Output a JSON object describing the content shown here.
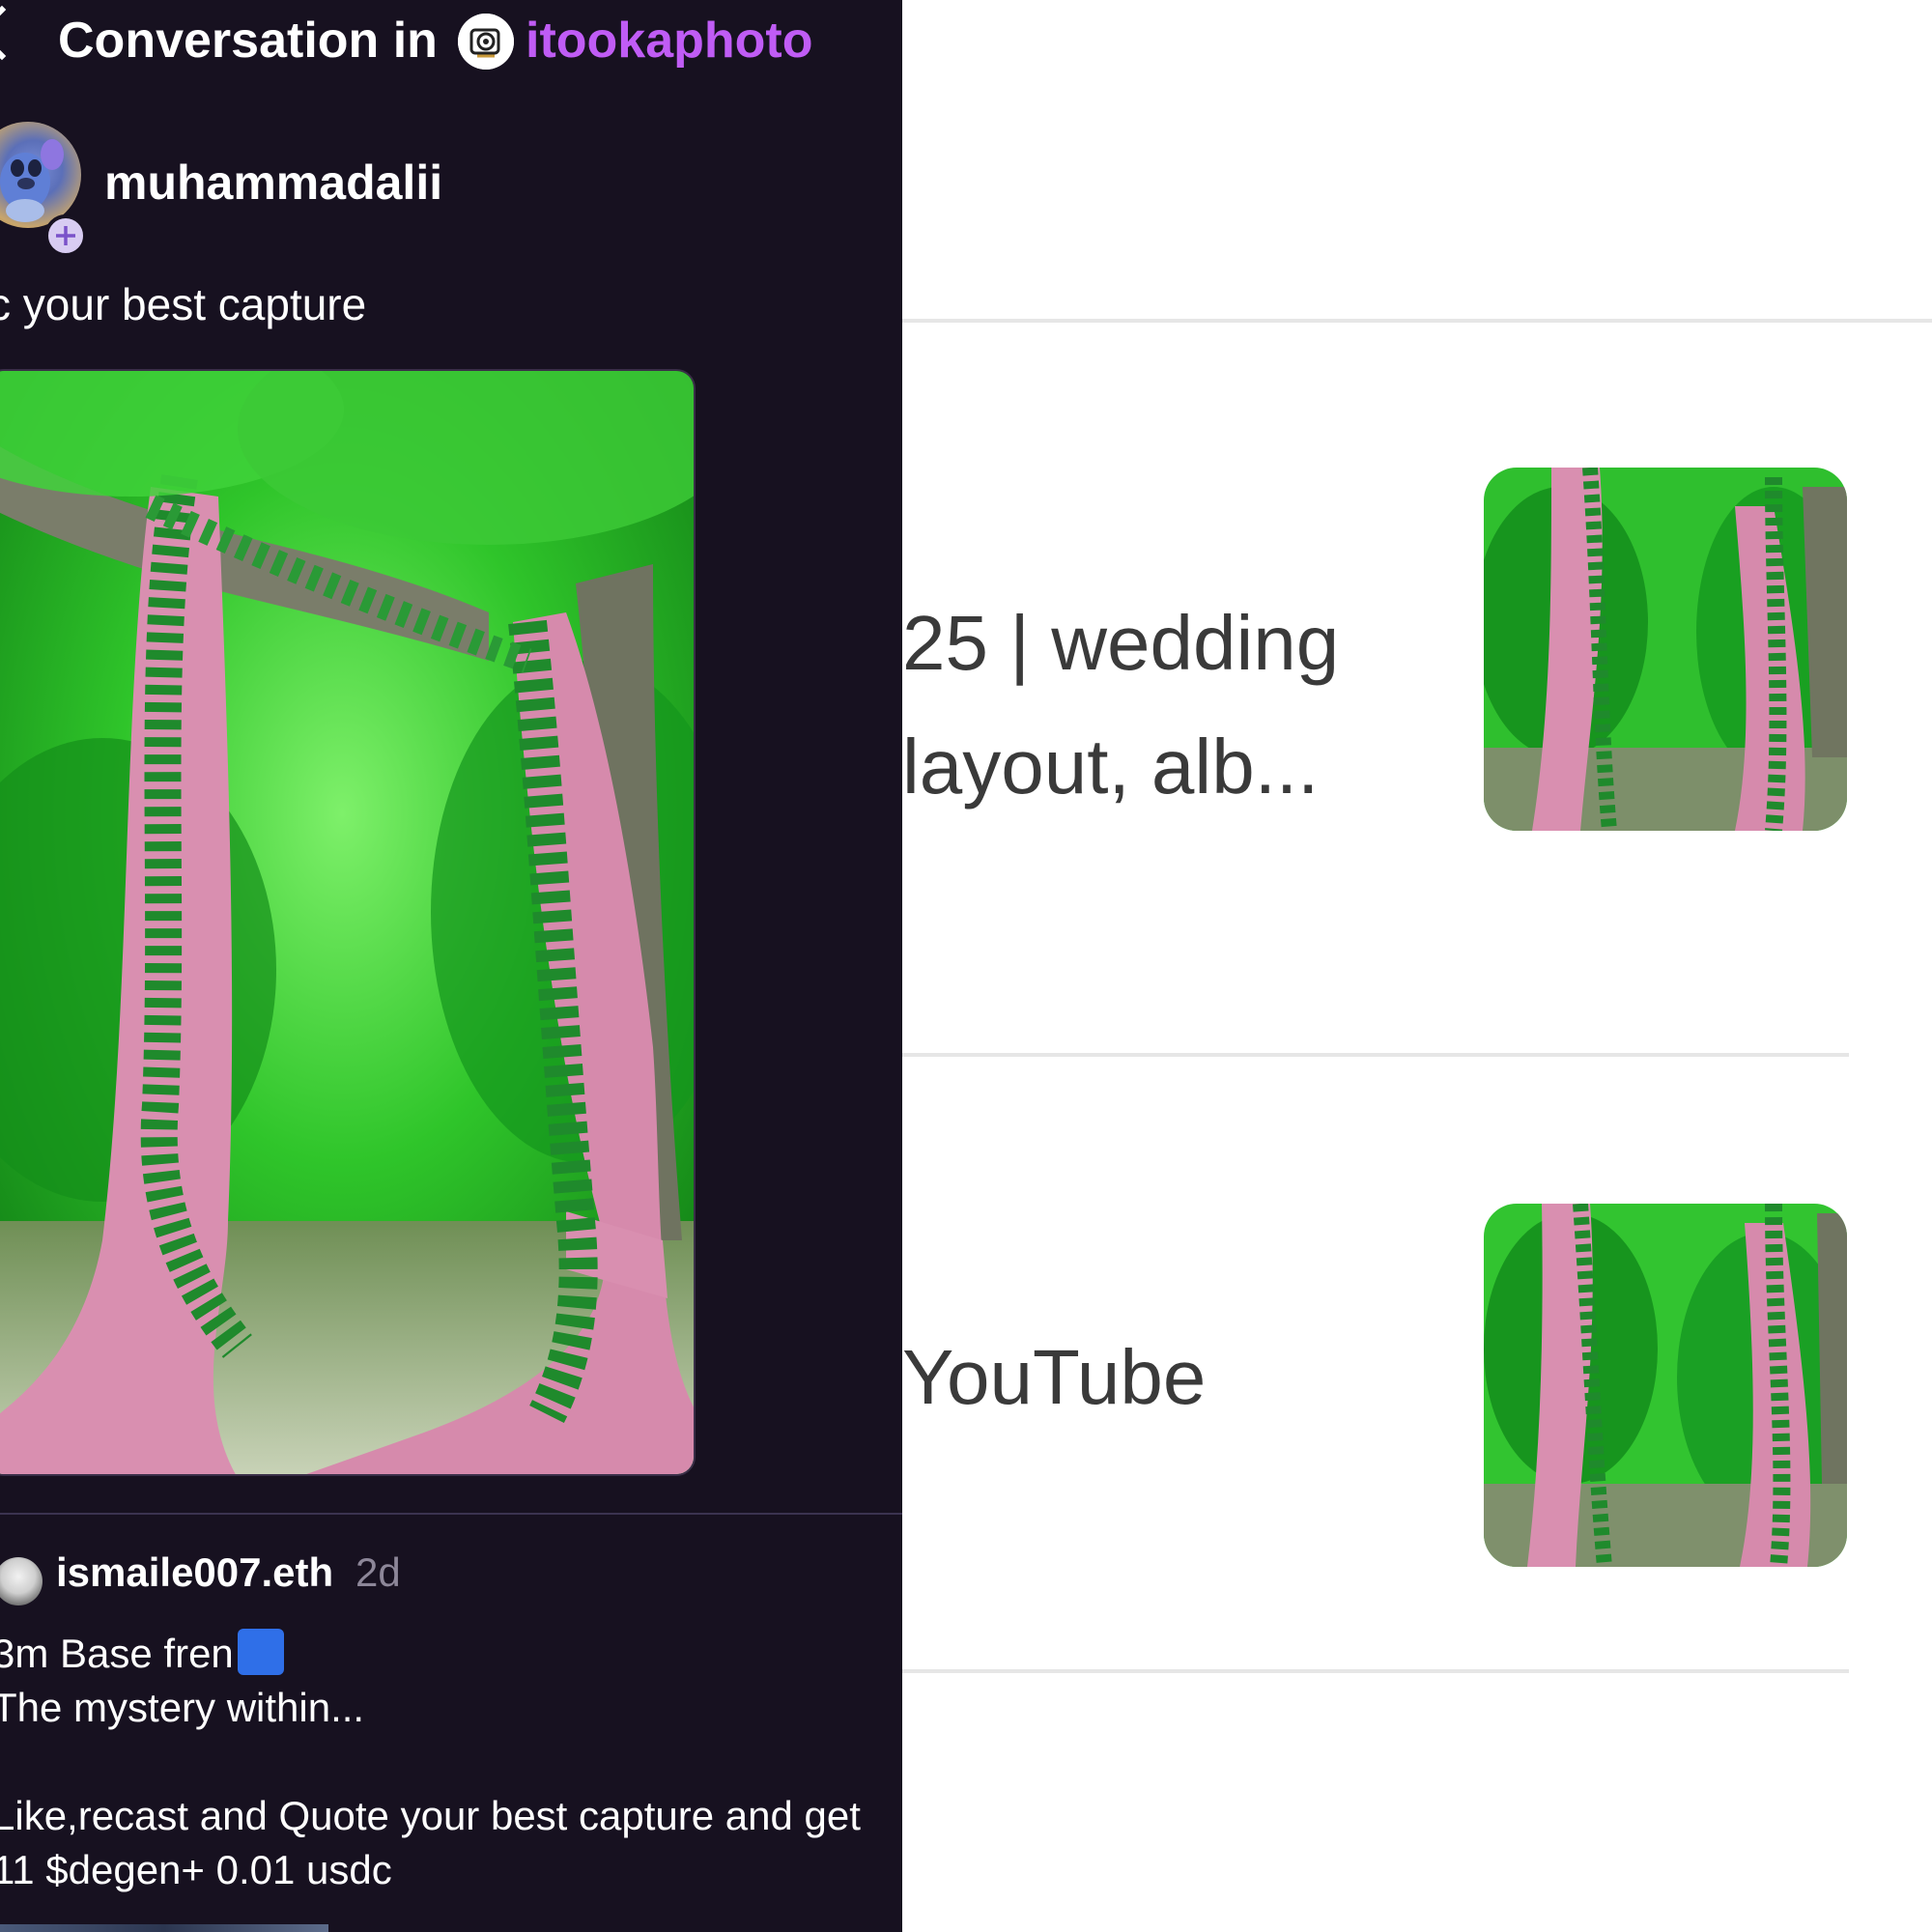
{
  "header": {
    "title": "Conversation in",
    "channel": "itookaphoto"
  },
  "post": {
    "username": "muhammadalii",
    "text": "c your best capture"
  },
  "reply": {
    "username": "ismaile007.eth",
    "time": "2d",
    "lines": [
      "3m Base fren",
      "The mystery within...",
      "Like,recast and Quote your best capture and get",
      "11 $degen+ 0.01 usdc"
    ]
  },
  "results": [
    {
      "title_line1": "25 | wedding",
      "title_line2": "layout, alb..."
    },
    {
      "title_line1": "YouTube"
    }
  ],
  "colors": {
    "dark_bg": "#171120",
    "channel_accent": "#c05cf5",
    "meta_gray": "#8d8799",
    "result_text": "#3a3a3a"
  }
}
